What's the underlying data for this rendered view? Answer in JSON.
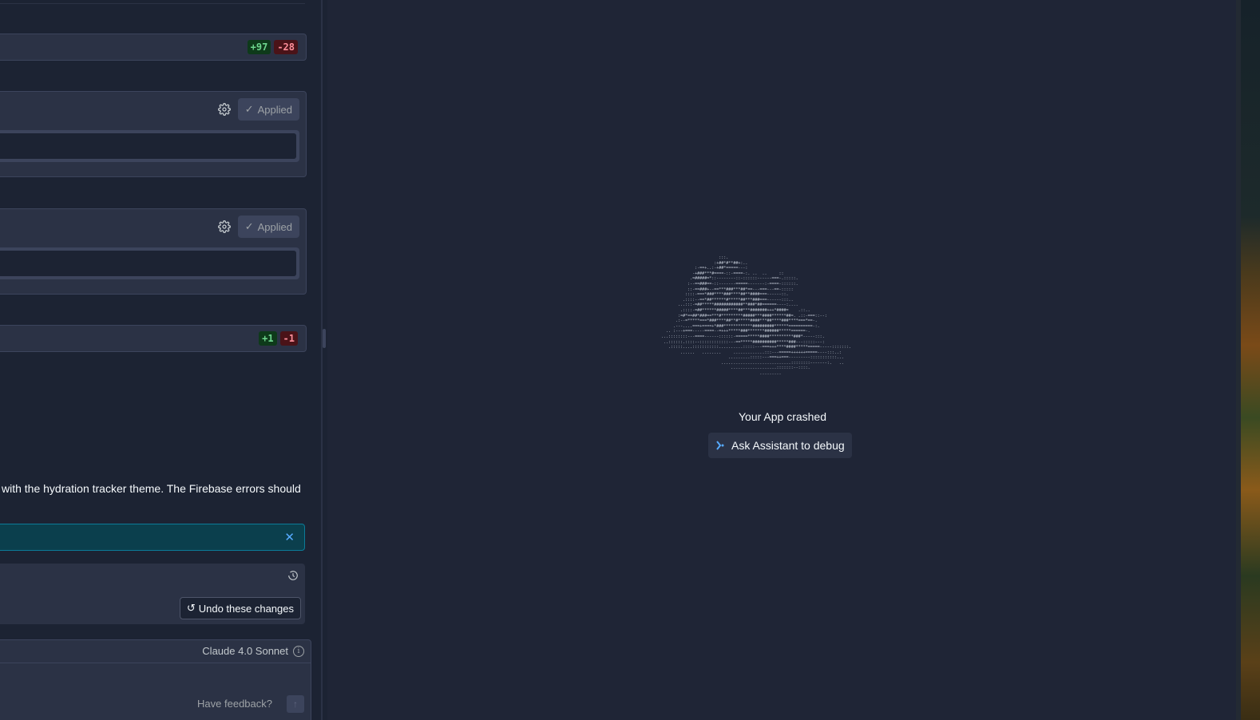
{
  "diff_summary_1": {
    "added": "+97",
    "removed": "-28"
  },
  "file_card_1": {
    "status": "Applied"
  },
  "file_card_2": {
    "status": "Applied"
  },
  "diff_summary_2": {
    "added": "+1",
    "removed": "-1"
  },
  "message": {
    "text": "with the hydration tracker theme. The Firebase errors should"
  },
  "banner": {
    "close_icon": "close-icon"
  },
  "checkpoint": {
    "undo_label": "Undo these changes"
  },
  "composer": {
    "model": "Claude 4.0 Sonnet",
    "feedback": "Have feedback?"
  },
  "preview": {
    "crash_title": "Your App crashed",
    "ask_button": "Ask Assistant to debug"
  },
  "colors": {
    "background": "#1c2333",
    "surface": "#2b3245",
    "accent_teal": "#0c7b98",
    "added": "#6ed68e",
    "removed": "#ff8f9a"
  }
}
